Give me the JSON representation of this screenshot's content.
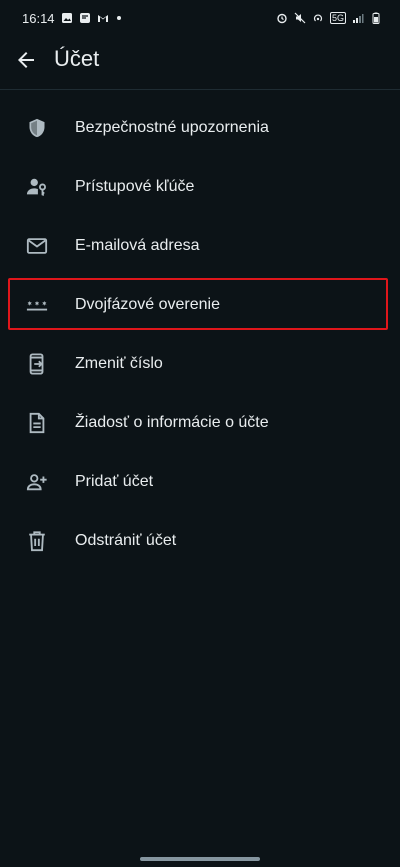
{
  "status": {
    "time": "16:14",
    "network": "5G"
  },
  "header": {
    "title": "Účet"
  },
  "menu": {
    "items": [
      {
        "label": "Bezpečnostné upozornenia",
        "icon": "shield-icon"
      },
      {
        "label": "Prístupové kľúče",
        "icon": "person-key-icon"
      },
      {
        "label": "E-mailová adresa",
        "icon": "email-icon"
      },
      {
        "label": "Dvojfázové overenie",
        "icon": "password-dots-icon"
      },
      {
        "label": "Zmeniť číslo",
        "icon": "phone-transfer-icon"
      },
      {
        "label": "Žiadosť o informácie o účte",
        "icon": "document-icon"
      },
      {
        "label": "Pridať účet",
        "icon": "add-person-icon"
      },
      {
        "label": "Odstrániť účet",
        "icon": "trash-icon"
      }
    ]
  },
  "colors": {
    "background": "#0c1317",
    "text": "#e9edef",
    "icon": "#aebac1",
    "highlight": "#e0161b"
  }
}
